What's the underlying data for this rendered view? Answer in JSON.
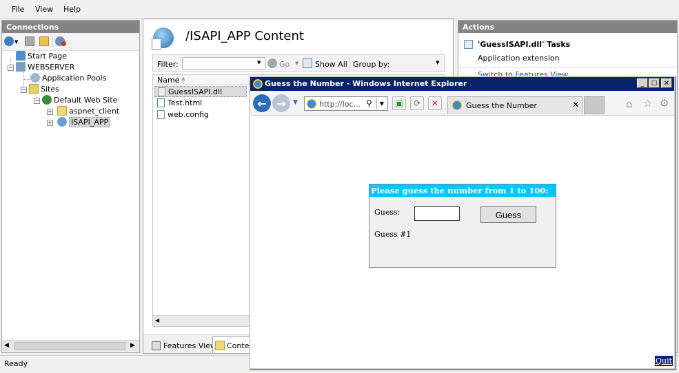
{
  "menu": {
    "file": "File",
    "view": "View",
    "help": "Help"
  },
  "connections": {
    "title": "Connections",
    "tree": {
      "start_page": "Start Page",
      "server": "WEBSERVER",
      "app_pools": "Application Pools",
      "sites": "Sites",
      "default_site": "Default Web Site",
      "aspnet_client": "aspnet_client",
      "isapi_app": "ISAPI_APP"
    }
  },
  "content": {
    "title": "/ISAPI_APP Content",
    "filter_label": "Filter:",
    "go_label": "Go",
    "show_all_label": "Show All",
    "group_by_label": "Group by:",
    "column_name": "Name",
    "files": [
      "GuessISAPI.dll",
      "Test.html",
      "web.config"
    ],
    "tab_features": "Features View",
    "tab_content": "Conten"
  },
  "actions": {
    "title": "Actions",
    "tasks_title": "'GuessISAPI.dll' Tasks",
    "subtitle": "Application extension",
    "switch_link": "Switch to Features View"
  },
  "status": {
    "text": "Ready"
  },
  "ie": {
    "title": "Guess the Number - Windows Internet Explorer",
    "address": "http://loc...",
    "tab_label": "Guess the Number",
    "quit": "Quit"
  },
  "game": {
    "heading": "Please guess the number from 1 to 100:",
    "guess_label": "Guess:",
    "guess_value": "",
    "guess_button": "Guess",
    "counter": "Guess #1"
  }
}
